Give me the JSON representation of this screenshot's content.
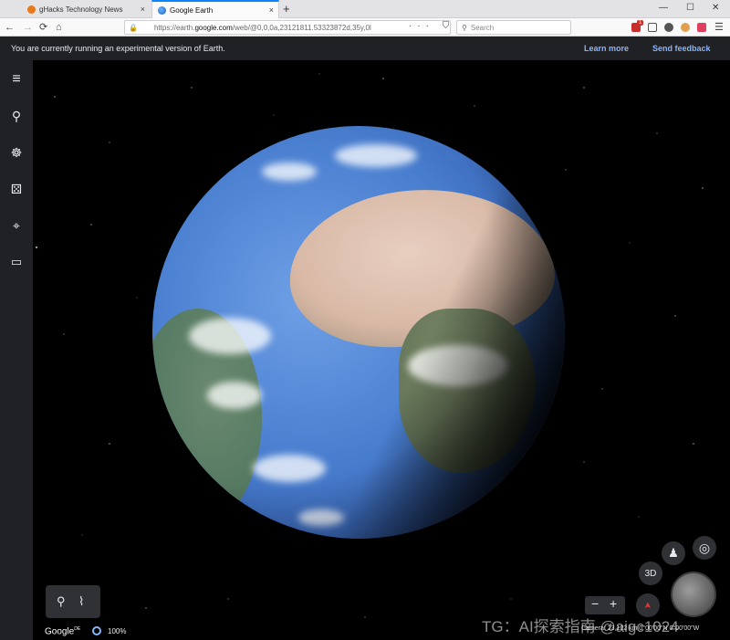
{
  "browser": {
    "tabs": [
      {
        "label": "gHacks Technology News",
        "close": "×"
      },
      {
        "label": "Google Earth",
        "close": "×"
      }
    ],
    "new_tab": "+",
    "window_controls": {
      "minimize": "—",
      "maximize": "☐",
      "close": "✕"
    },
    "nav": {
      "back": "←",
      "forward": "→",
      "reload": "⟳",
      "home": "⌂"
    },
    "url": {
      "prefix": "https://earth.",
      "host": "google.com",
      "path": "/web/@0,0,0a,23121811.53323872d,35y,0l"
    },
    "url_actions": "··· ⛉ ☆",
    "search": {
      "placeholder": "Search",
      "icon": "search-icon"
    },
    "extension_badge": "1",
    "menu": "☰"
  },
  "infobar": {
    "message": "You are currently running an experimental version of Earth.",
    "learn_more": "Learn more",
    "send_feedback": "Send feedback"
  },
  "sidebar": {
    "items": [
      {
        "icon": "menu-icon",
        "glyph": "≡"
      },
      {
        "icon": "search-icon",
        "glyph": "⚲"
      },
      {
        "icon": "voyager-icon",
        "glyph": "☸"
      },
      {
        "icon": "feeling-lucky-icon",
        "glyph": "⚄"
      },
      {
        "icon": "projects-icon",
        "glyph": "⌖"
      },
      {
        "icon": "measure-icon",
        "glyph": "▭"
      }
    ]
  },
  "map_tools": {
    "placemark": "⚲",
    "path": "⌇"
  },
  "footer": {
    "logo": "Google",
    "logo_suffix": "DE",
    "load_percent": "100%",
    "camera": "Camera: 23,122 km  0°00'00\"N 0°00'00\"W"
  },
  "controls": {
    "pegman": "♟",
    "my_location": "◎",
    "view_3d": "3D",
    "zoom_out": "−",
    "zoom_in": "+",
    "compass": "➤"
  },
  "watermark": "TG：AI探索指南 @aigc1024",
  "colors": {
    "infobar_bg": "#202124",
    "link": "#8ab4f8",
    "tab_accent": "#0a84ff"
  }
}
